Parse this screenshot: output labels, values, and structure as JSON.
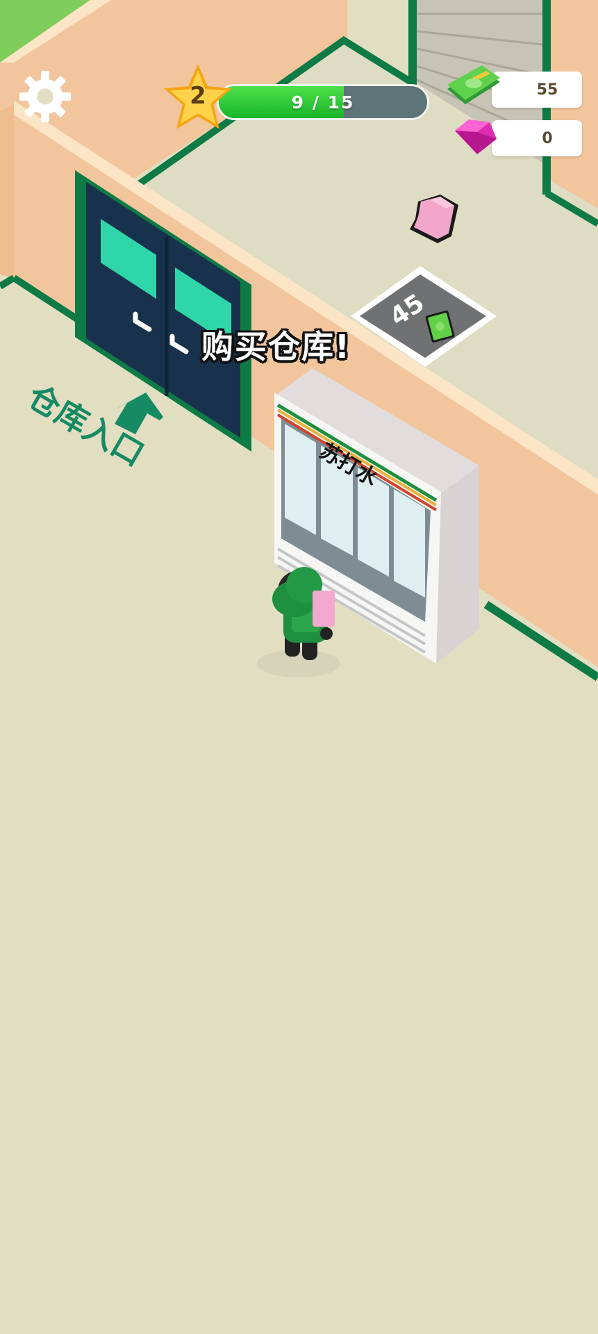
{
  "hud": {
    "level": "2",
    "progress_text": "9 / 15",
    "progress_fraction": 0.6,
    "cash": "55",
    "gems": "0"
  },
  "world": {
    "floor_sign": "仓库入口",
    "buy_zone_price": "45",
    "fridge_sign": "苏打水"
  },
  "toast": "购买仓库!",
  "colors": {
    "floor": "#e2dec2",
    "wall": "#f2c59c",
    "trim": "#0e7a45",
    "door": "#18324d",
    "accent_green": "#1fbf3a"
  }
}
